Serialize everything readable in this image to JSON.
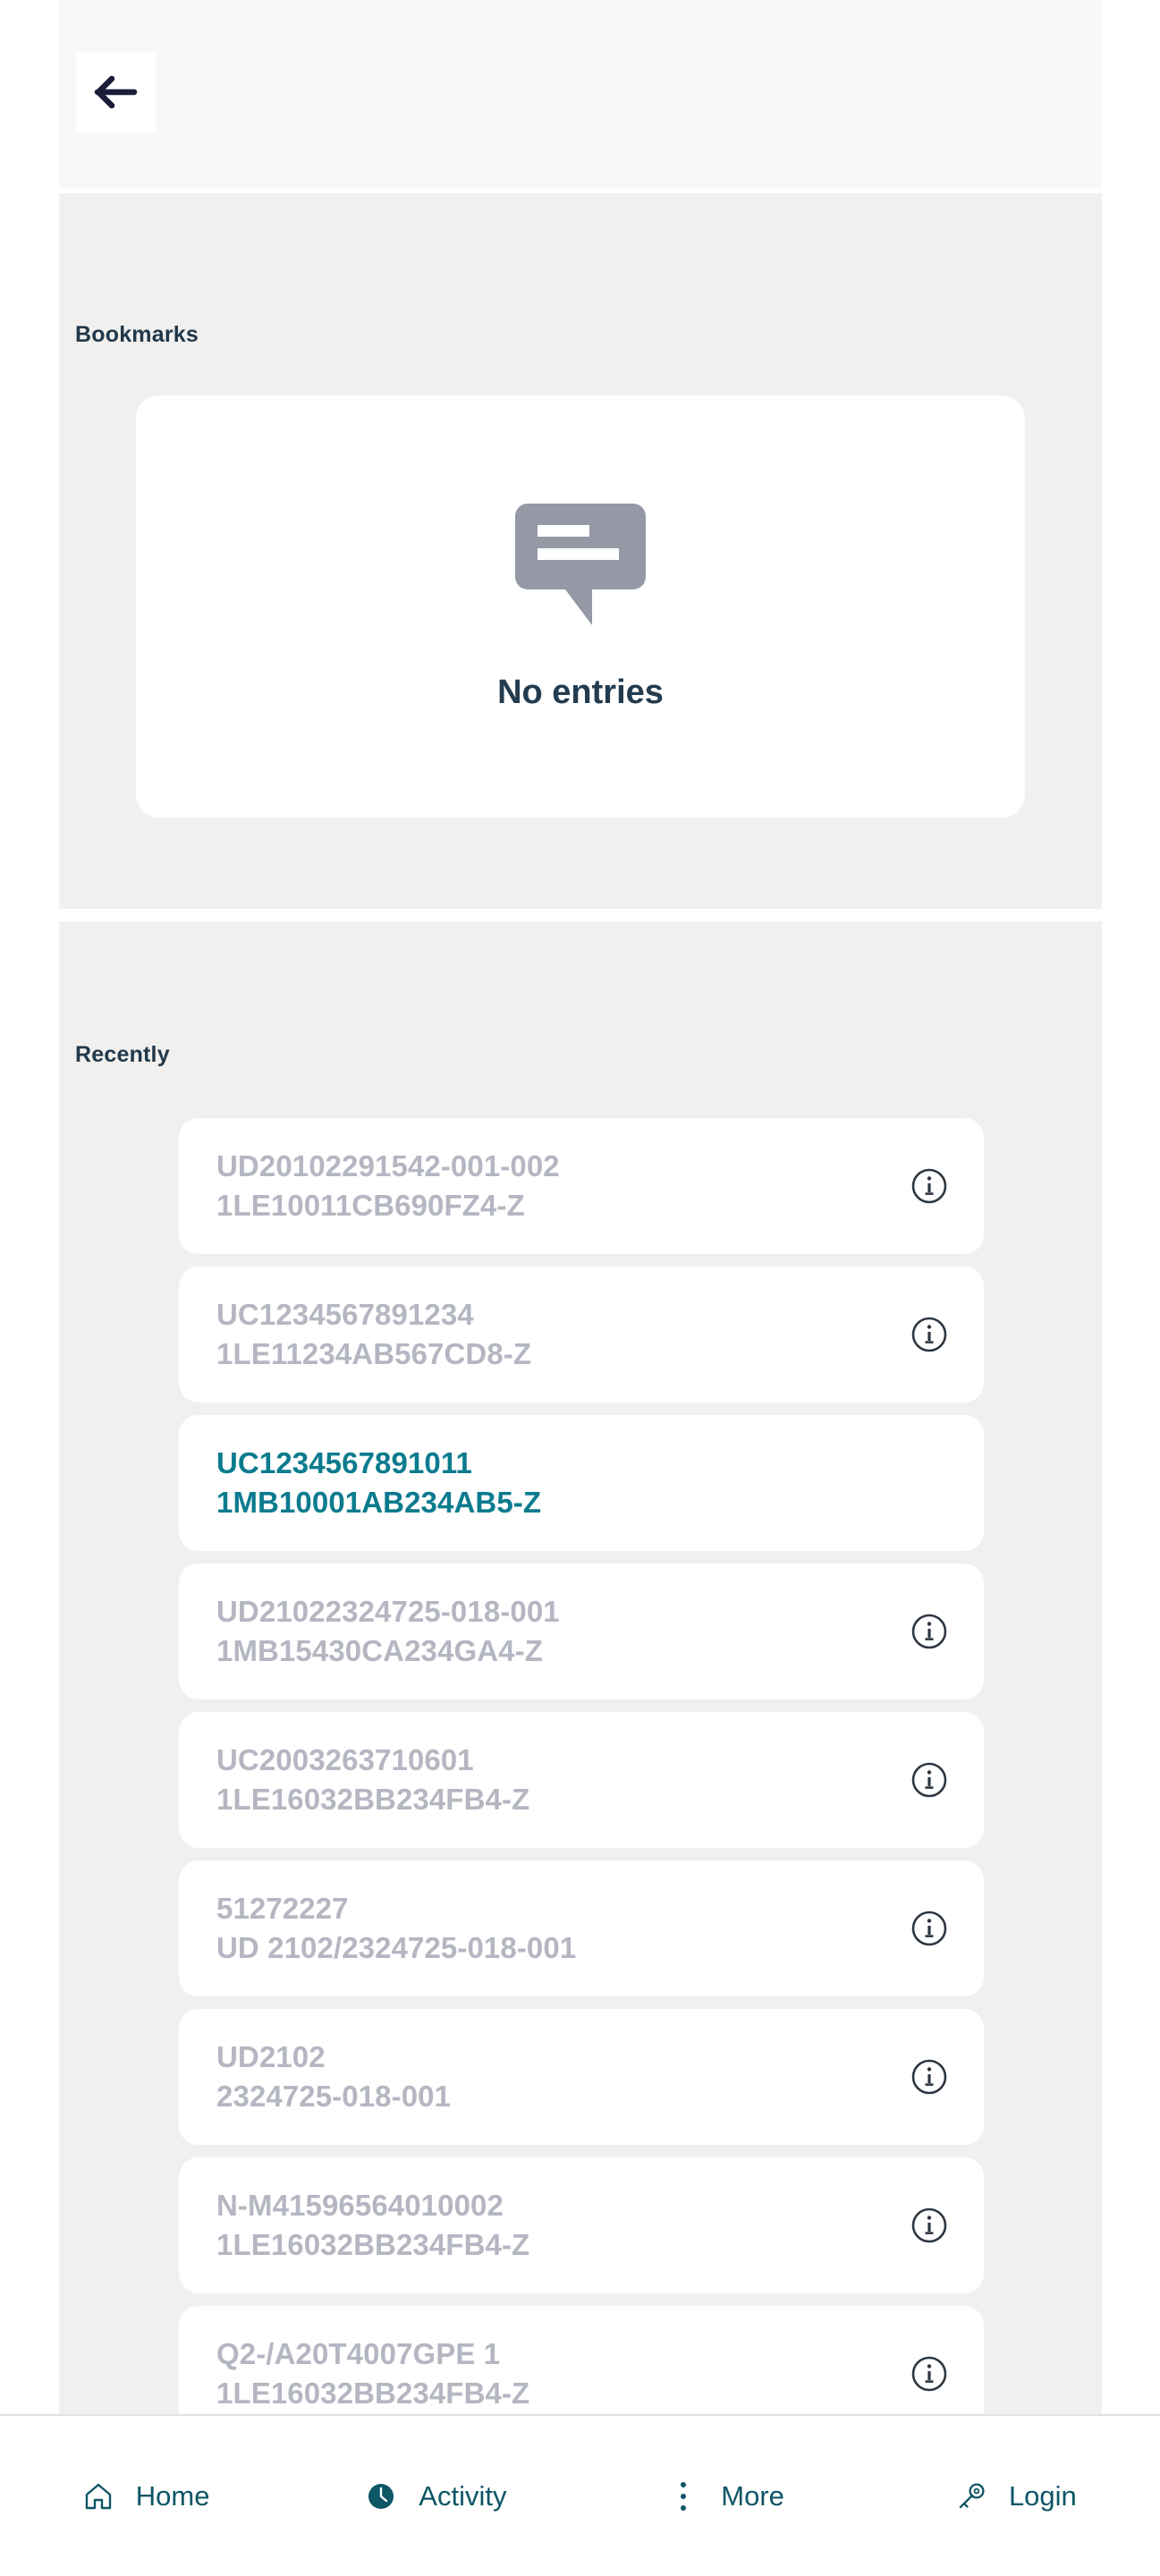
{
  "header": {
    "back_icon": "arrow-left-icon"
  },
  "bookmarks": {
    "title": "Bookmarks",
    "empty_icon": "speech-bubble-icon",
    "empty_label": "No entries"
  },
  "recently": {
    "title": "Recently",
    "items": [
      {
        "line1": "UD20102291542-001-002",
        "line2": "1LE10011CB690FZ4-Z",
        "active": false,
        "has_info": true
      },
      {
        "line1": "UC1234567891234",
        "line2": "1LE11234AB567CD8-Z",
        "active": false,
        "has_info": true
      },
      {
        "line1": "UC1234567891011",
        "line2": "1MB10001AB234AB5-Z",
        "active": true,
        "has_info": false
      },
      {
        "line1": "UD21022324725-018-001",
        "line2": "1MB15430CA234GA4-Z",
        "active": false,
        "has_info": true
      },
      {
        "line1": "UC2003263710601",
        "line2": "1LE16032BB234FB4-Z",
        "active": false,
        "has_info": true
      },
      {
        "line1": "51272227",
        "line2": "UD 2102/2324725-018-001",
        "active": false,
        "has_info": true
      },
      {
        "line1": "UD2102",
        "line2": "2324725-018-001",
        "active": false,
        "has_info": true
      },
      {
        "line1": "N-M41596564010002",
        "line2": "1LE16032BB234FB4-Z",
        "active": false,
        "has_info": true
      },
      {
        "line1": "Q2-/A20T4007GPE 1",
        "line2": "1LE16032BB234FB4-Z",
        "active": false,
        "has_info": true
      }
    ],
    "info_icon": "info-icon"
  },
  "bottom_nav": {
    "items": [
      {
        "label": "Home",
        "icon": "home-icon"
      },
      {
        "label": "Activity",
        "icon": "clock-icon"
      },
      {
        "label": "More",
        "icon": "more-vertical-icon"
      },
      {
        "label": "Login",
        "icon": "key-icon"
      }
    ]
  },
  "colors": {
    "panel_bg": "#f0f0ee",
    "header_bg": "#f7f8f8",
    "card_bg": "#ffffff",
    "muted_text": "#b4b7c2",
    "accent_teal": "#0b7b8e",
    "heading_navy": "#22384a",
    "nav_text": "#0d5666",
    "back_arrow": "#1b1b3a"
  }
}
